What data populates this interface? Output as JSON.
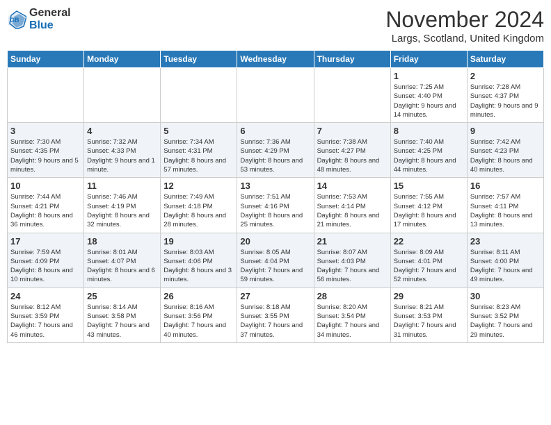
{
  "logo": {
    "general": "General",
    "blue": "Blue"
  },
  "title": "November 2024",
  "subtitle": "Largs, Scotland, United Kingdom",
  "days_of_week": [
    "Sunday",
    "Monday",
    "Tuesday",
    "Wednesday",
    "Thursday",
    "Friday",
    "Saturday"
  ],
  "weeks": [
    [
      {
        "day": "",
        "info": ""
      },
      {
        "day": "",
        "info": ""
      },
      {
        "day": "",
        "info": ""
      },
      {
        "day": "",
        "info": ""
      },
      {
        "day": "",
        "info": ""
      },
      {
        "day": "1",
        "info": "Sunrise: 7:25 AM\nSunset: 4:40 PM\nDaylight: 9 hours and 14 minutes."
      },
      {
        "day": "2",
        "info": "Sunrise: 7:28 AM\nSunset: 4:37 PM\nDaylight: 9 hours and 9 minutes."
      }
    ],
    [
      {
        "day": "3",
        "info": "Sunrise: 7:30 AM\nSunset: 4:35 PM\nDaylight: 9 hours and 5 minutes."
      },
      {
        "day": "4",
        "info": "Sunrise: 7:32 AM\nSunset: 4:33 PM\nDaylight: 9 hours and 1 minute."
      },
      {
        "day": "5",
        "info": "Sunrise: 7:34 AM\nSunset: 4:31 PM\nDaylight: 8 hours and 57 minutes."
      },
      {
        "day": "6",
        "info": "Sunrise: 7:36 AM\nSunset: 4:29 PM\nDaylight: 8 hours and 53 minutes."
      },
      {
        "day": "7",
        "info": "Sunrise: 7:38 AM\nSunset: 4:27 PM\nDaylight: 8 hours and 48 minutes."
      },
      {
        "day": "8",
        "info": "Sunrise: 7:40 AM\nSunset: 4:25 PM\nDaylight: 8 hours and 44 minutes."
      },
      {
        "day": "9",
        "info": "Sunrise: 7:42 AM\nSunset: 4:23 PM\nDaylight: 8 hours and 40 minutes."
      }
    ],
    [
      {
        "day": "10",
        "info": "Sunrise: 7:44 AM\nSunset: 4:21 PM\nDaylight: 8 hours and 36 minutes."
      },
      {
        "day": "11",
        "info": "Sunrise: 7:46 AM\nSunset: 4:19 PM\nDaylight: 8 hours and 32 minutes."
      },
      {
        "day": "12",
        "info": "Sunrise: 7:49 AM\nSunset: 4:18 PM\nDaylight: 8 hours and 28 minutes."
      },
      {
        "day": "13",
        "info": "Sunrise: 7:51 AM\nSunset: 4:16 PM\nDaylight: 8 hours and 25 minutes."
      },
      {
        "day": "14",
        "info": "Sunrise: 7:53 AM\nSunset: 4:14 PM\nDaylight: 8 hours and 21 minutes."
      },
      {
        "day": "15",
        "info": "Sunrise: 7:55 AM\nSunset: 4:12 PM\nDaylight: 8 hours and 17 minutes."
      },
      {
        "day": "16",
        "info": "Sunrise: 7:57 AM\nSunset: 4:11 PM\nDaylight: 8 hours and 13 minutes."
      }
    ],
    [
      {
        "day": "17",
        "info": "Sunrise: 7:59 AM\nSunset: 4:09 PM\nDaylight: 8 hours and 10 minutes."
      },
      {
        "day": "18",
        "info": "Sunrise: 8:01 AM\nSunset: 4:07 PM\nDaylight: 8 hours and 6 minutes."
      },
      {
        "day": "19",
        "info": "Sunrise: 8:03 AM\nSunset: 4:06 PM\nDaylight: 8 hours and 3 minutes."
      },
      {
        "day": "20",
        "info": "Sunrise: 8:05 AM\nSunset: 4:04 PM\nDaylight: 7 hours and 59 minutes."
      },
      {
        "day": "21",
        "info": "Sunrise: 8:07 AM\nSunset: 4:03 PM\nDaylight: 7 hours and 56 minutes."
      },
      {
        "day": "22",
        "info": "Sunrise: 8:09 AM\nSunset: 4:01 PM\nDaylight: 7 hours and 52 minutes."
      },
      {
        "day": "23",
        "info": "Sunrise: 8:11 AM\nSunset: 4:00 PM\nDaylight: 7 hours and 49 minutes."
      }
    ],
    [
      {
        "day": "24",
        "info": "Sunrise: 8:12 AM\nSunset: 3:59 PM\nDaylight: 7 hours and 46 minutes."
      },
      {
        "day": "25",
        "info": "Sunrise: 8:14 AM\nSunset: 3:58 PM\nDaylight: 7 hours and 43 minutes."
      },
      {
        "day": "26",
        "info": "Sunrise: 8:16 AM\nSunset: 3:56 PM\nDaylight: 7 hours and 40 minutes."
      },
      {
        "day": "27",
        "info": "Sunrise: 8:18 AM\nSunset: 3:55 PM\nDaylight: 7 hours and 37 minutes."
      },
      {
        "day": "28",
        "info": "Sunrise: 8:20 AM\nSunset: 3:54 PM\nDaylight: 7 hours and 34 minutes."
      },
      {
        "day": "29",
        "info": "Sunrise: 8:21 AM\nSunset: 3:53 PM\nDaylight: 7 hours and 31 minutes."
      },
      {
        "day": "30",
        "info": "Sunrise: 8:23 AM\nSunset: 3:52 PM\nDaylight: 7 hours and 29 minutes."
      }
    ]
  ]
}
